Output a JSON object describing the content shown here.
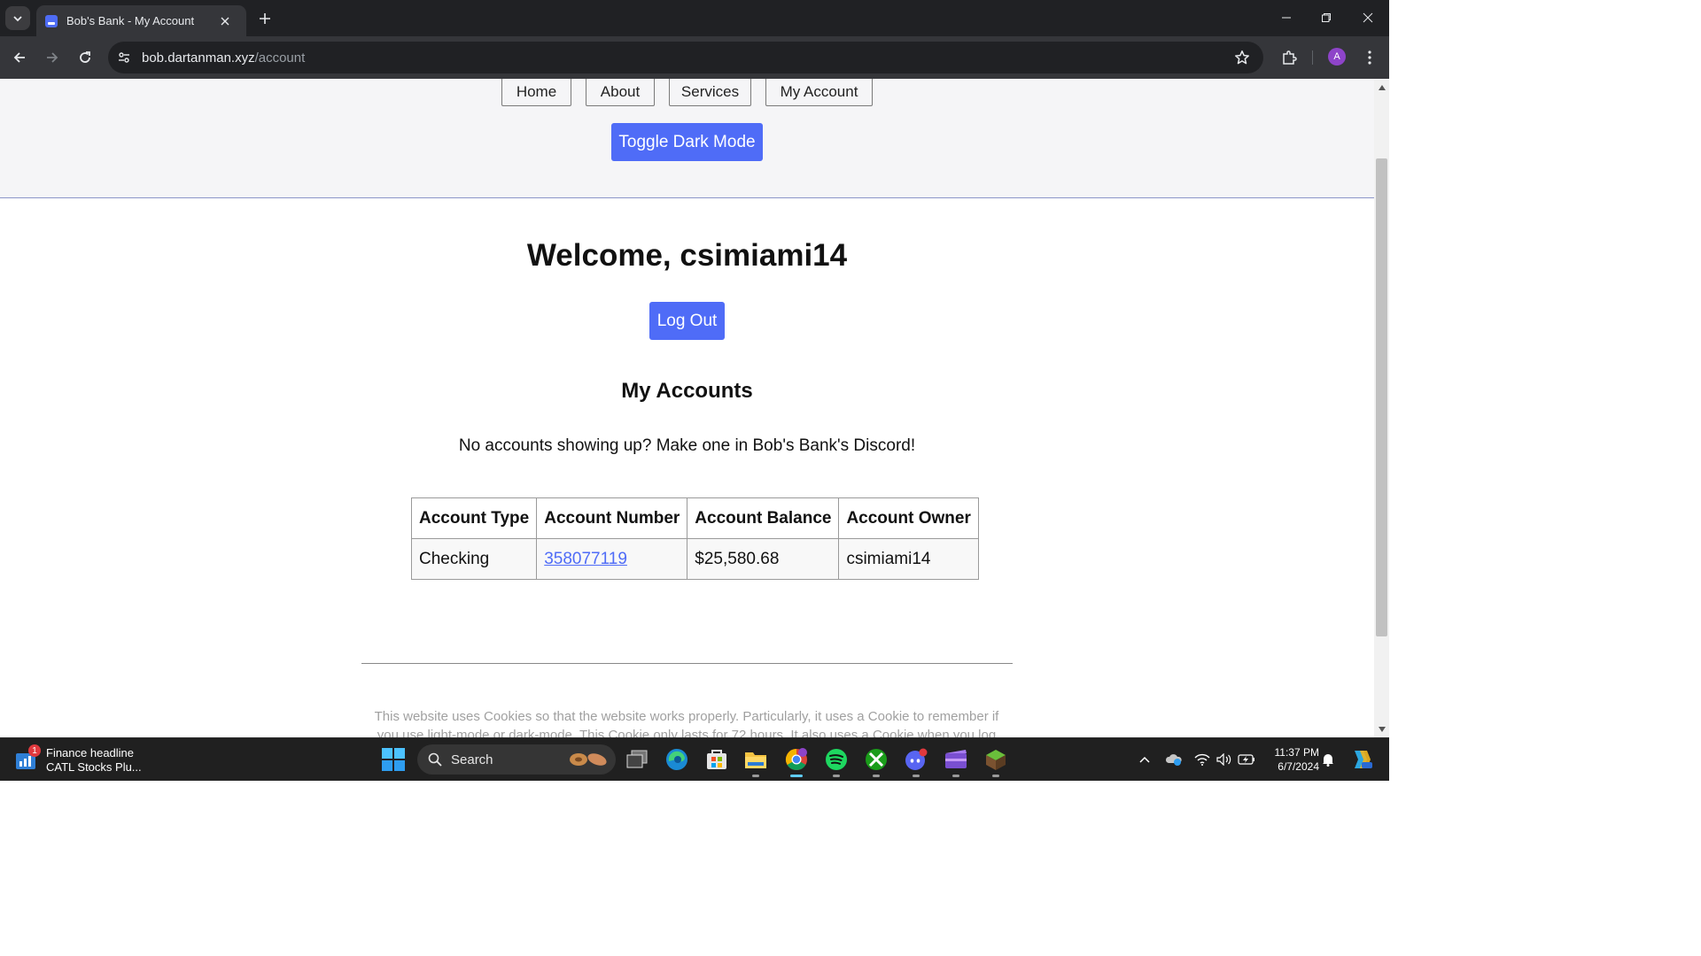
{
  "browser": {
    "tab_title": "Bob's Bank - My Account",
    "url_host": "bob.dartanman.xyz",
    "url_path": "/account",
    "profile_initial": "A"
  },
  "site": {
    "nav": [
      "Home",
      "About",
      "Services",
      "My Account"
    ],
    "toggle_dark_mode": "Toggle Dark Mode",
    "brand_color": "#4f6cf7"
  },
  "account": {
    "welcome": "Welcome, csimiami14",
    "logout": "Log Out",
    "heading": "My Accounts",
    "notice": "No accounts showing up? Make one in Bob's Bank's Discord!",
    "table": {
      "headers": [
        "Account Type",
        "Account Number",
        "Account Balance",
        "Account Owner"
      ],
      "rows": [
        {
          "type": "Checking",
          "number": "358077119",
          "balance": "$25,580.68",
          "owner": "csimiami14"
        }
      ]
    },
    "cookie_notice": "This website uses Cookies so that the website works properly. Particularly, it uses a Cookie to remember if you use light-mode or dark-mode. This Cookie only lasts for 72 hours. It also uses a Cookie when you log in"
  },
  "taskbar": {
    "widget_badge": "1",
    "widget_title": "Finance headline",
    "widget_subtitle": "CATL Stocks Plu...",
    "search_label": "Search",
    "time": "11:37 PM",
    "date": "6/7/2024",
    "icons": [
      "windows-start-icon",
      "file-explorer-icon",
      "edge-icon",
      "store-icon",
      "folder-icon",
      "chrome-icon",
      "spotify-icon",
      "xbox-icon",
      "discord-icon",
      "clipchamp-icon",
      "minecraft-icon"
    ]
  }
}
